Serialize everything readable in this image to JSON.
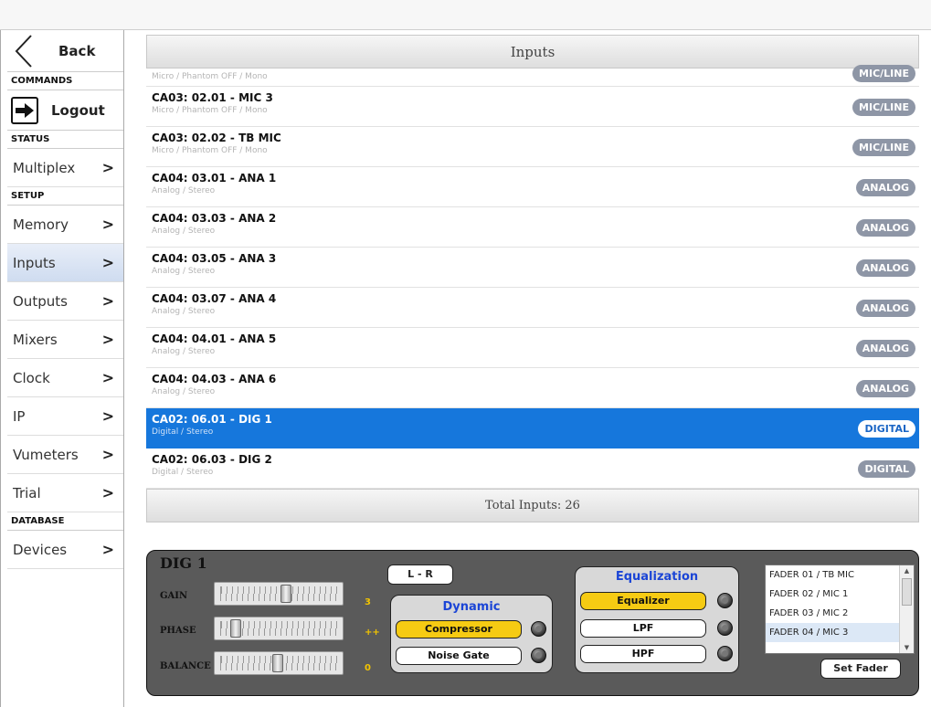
{
  "sidebar": {
    "back_label": "Back",
    "sections": {
      "commands": "COMMANDS",
      "status": "STATUS",
      "setup": "SETUP",
      "database": "DATABASE"
    },
    "logout_label": "Logout",
    "status_items": [
      {
        "label": "Multiplex"
      }
    ],
    "setup_items": [
      {
        "label": "Memory"
      },
      {
        "label": "Inputs",
        "active": true
      },
      {
        "label": "Outputs"
      },
      {
        "label": "Mixers"
      },
      {
        "label": "Clock"
      },
      {
        "label": "IP"
      },
      {
        "label": "Vumeters"
      },
      {
        "label": "Trial"
      }
    ],
    "database_items": [
      {
        "label": "Devices"
      }
    ]
  },
  "inputs": {
    "title": "Inputs",
    "rows": [
      {
        "name": "",
        "desc": "Micro / Phantom OFF / Mono",
        "type": "MIC/LINE"
      },
      {
        "name": "CA03: 02.01  -  MIC 3",
        "desc": "Micro / Phantom OFF / Mono",
        "type": "MIC/LINE"
      },
      {
        "name": "CA03: 02.02  -  TB MIC",
        "desc": "Micro / Phantom OFF / Mono",
        "type": "MIC/LINE"
      },
      {
        "name": "CA04: 03.01  -  ANA 1",
        "desc": "Analog / Stereo",
        "type": "ANALOG"
      },
      {
        "name": "CA04: 03.03  -  ANA 2",
        "desc": "Analog / Stereo",
        "type": "ANALOG"
      },
      {
        "name": "CA04: 03.05  -  ANA 3",
        "desc": "Analog / Stereo",
        "type": "ANALOG"
      },
      {
        "name": "CA04: 03.07  -  ANA 4",
        "desc": "Analog / Stereo",
        "type": "ANALOG"
      },
      {
        "name": "CA04: 04.01  -  ANA 5",
        "desc": "Analog / Stereo",
        "type": "ANALOG"
      },
      {
        "name": "CA04: 04.03  -  ANA 6",
        "desc": "Analog / Stereo",
        "type": "ANALOG"
      },
      {
        "name": "CA02: 06.01  -  DIG 1",
        "desc": "Digital / Stereo",
        "type": "DIGITAL",
        "selected": true
      },
      {
        "name": "CA02: 06.03  -  DIG 2",
        "desc": "Digital / Stereo",
        "type": "DIGITAL"
      }
    ],
    "total_label": "Total Inputs: 26"
  },
  "control": {
    "channel_name": "DIG 1",
    "gain": {
      "label": "GAIN",
      "value": "3",
      "position": 0.58
    },
    "phase": {
      "label": "PHASE",
      "value": "++",
      "position": 0.1
    },
    "balance": {
      "label": "BALANCE",
      "value": "0",
      "position": 0.5
    },
    "lr_label": "L - R",
    "dynamic": {
      "title": "Dynamic",
      "compressor": "Compressor",
      "noise_gate": "Noise Gate"
    },
    "equalization": {
      "title": "Equalization",
      "equalizer": "Equalizer",
      "lpf": "LPF",
      "hpf": "HPF"
    },
    "faders": [
      "FADER 01 / TB MIC",
      "FADER 02 / MIC 1",
      "FADER 03 / MIC 2",
      "FADER 04 / MIC 3"
    ],
    "set_fader_label": "Set Fader"
  },
  "colors": {
    "selection": "#1677dc",
    "badge": "#8e96a6",
    "active_toggle": "#f6cb13",
    "section_title": "#1b45d6",
    "slider_value": "#f2c400"
  }
}
